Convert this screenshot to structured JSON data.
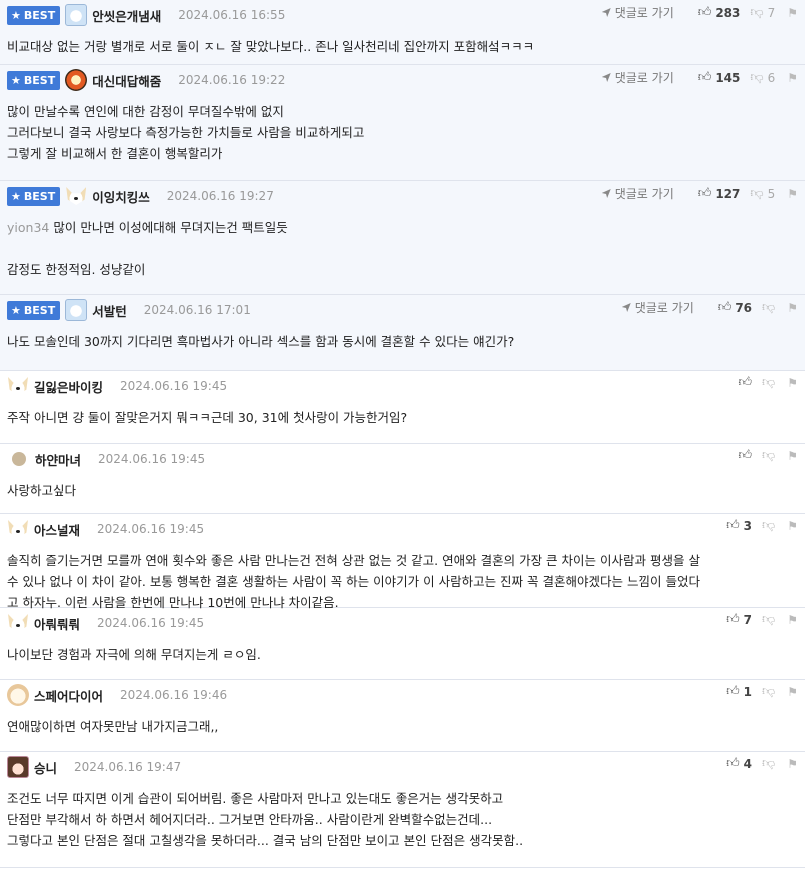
{
  "best_label": "BEST",
  "reply_label": "댓글로 가기",
  "comments": [
    {
      "best": true,
      "avatar": "bear-icon",
      "nick": "안씻은개냄새",
      "date": "2024.06.16 16:55",
      "up": "283",
      "down": "7",
      "lines": [
        "비교대상 없는 거랑 별개로 서로 둘이 ㅈㄴ 잘 맞았나보다.. 존나 일사천리네 집안까지 포함해섴ㅋㅋㅋ"
      ]
    },
    {
      "best": true,
      "avatar": "red-mask-icon",
      "nick": "대신대답해줌",
      "date": "2024.06.16 19:22",
      "up": "145",
      "down": "6",
      "lines": [
        "많이 만날수록 연인에 대한 감정이 무뎌질수밖에 없지",
        "그러다보니 결국 사랑보다 측정가능한 가치들로 사람을 비교하게되고",
        "그렇게 잘 비교해서 한 결혼이 행복할리가"
      ]
    },
    {
      "best": true,
      "avatar": "fox-icon",
      "nick": "이잉치킹쓰",
      "date": "2024.06.16 19:27",
      "up": "127",
      "down": "5",
      "quote": "yion34",
      "lines": [
        "많이 만나면 이성에대해 무뎌지는건 팩트일듯",
        "",
        "감정도 한정적임. 성냥같이"
      ]
    },
    {
      "best": true,
      "avatar": "bear-icon",
      "nick": "서발턴",
      "date": "2024.06.16 17:01",
      "up": "76",
      "down": "",
      "lines": [
        "나도 모솔인데 30까지 기다리면 흑마법사가 아니라 섹스를 함과 동시에 결혼할 수 있다는 얘긴가?"
      ]
    },
    {
      "best": false,
      "avatar": "fox-icon",
      "nick": "길잃은바이킹",
      "date": "2024.06.16 19:45",
      "up": "",
      "down": "",
      "lines": [
        "주작 아니면 걍 둘이 잘맞은거지 뭐ㅋㅋ근데 30, 31에 첫사랑이 가능한거임?"
      ]
    },
    {
      "best": false,
      "avatar": "dot-icon",
      "nick": "하얀마녀",
      "date": "2024.06.16 19:45",
      "up": "",
      "down": "",
      "lines": [
        "사랑하고싶다"
      ]
    },
    {
      "best": false,
      "avatar": "fox-icon",
      "nick": "아스널재",
      "date": "2024.06.16 19:45",
      "up": "3",
      "down": "",
      "lines": [
        "솔직히 즐기는거면 모를까 연애 횟수와 좋은 사람 만나는건 전혀 상관 없는 것 같고. 연애와 결혼의 가장 큰 차이는 이사람과 평생을 살",
        "수 있나 없나 이 차이 같아. 보통 행복한 결혼 생활하는 사람이 꼭 하는 이야기가 이 사람하고는 진짜 꼭 결혼해야겠다는 느낌이 들었다",
        "고 하자누. 이런 사람을 한번에 만나냐 10번에 만나냐 차이같음."
      ]
    },
    {
      "best": false,
      "avatar": "fox-icon",
      "nick": "아뤄뤄뤄",
      "date": "2024.06.16 19:45",
      "up": "7",
      "down": "",
      "lines": [
        "나이보단 경험과 자극에 의해 무뎌지는게 ㄹㅇ임."
      ]
    },
    {
      "best": false,
      "avatar": "puppy-icon",
      "nick": "스페어다이어",
      "date": "2024.06.16 19:46",
      "up": "1",
      "down": "",
      "lines": [
        "연애많이하면 여자못만남 내가지금그래,,"
      ]
    },
    {
      "best": false,
      "avatar": "girl-icon",
      "nick": "승니",
      "date": "2024.06.16 19:47",
      "up": "4",
      "down": "",
      "lines": [
        "조건도 너무 따지면 이게 습관이 되어버림. 좋은 사람마저 만나고 있는대도 좋은거는 생각못하고",
        "단점만 부각해서 하 하면서 헤어지더라.. 그거보면 안타까움.. 사람이란게 완벽할수없는건데...",
        "그렇다고 본인 단점은 절대 고칠생각을 못하더라... 결국 남의 단점만 보이고 본인 단점은 생각못함.."
      ]
    }
  ]
}
